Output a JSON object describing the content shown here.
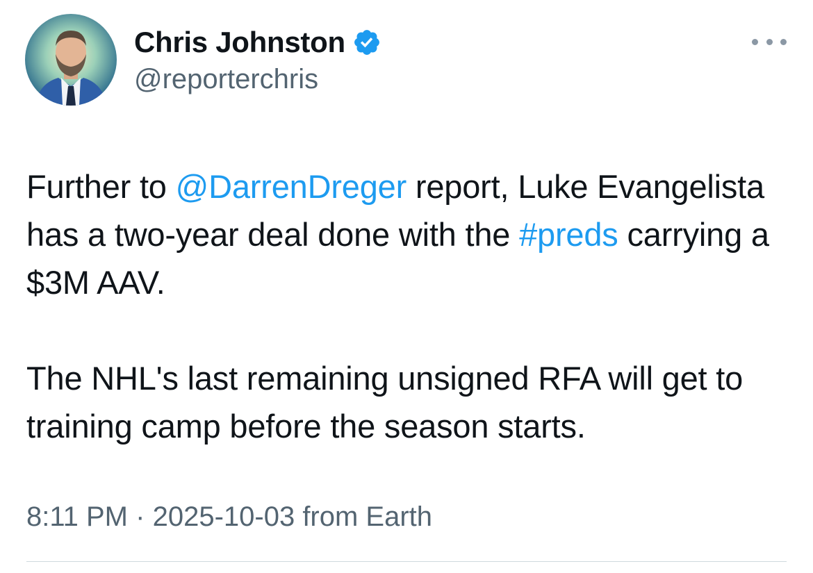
{
  "author": {
    "display_name": "Chris Johnston",
    "handle": "@reporterchris",
    "verified_icon": "verified-badge-icon",
    "verified_color": "#1d9bf0"
  },
  "menu": {
    "icon": "more-options-icon"
  },
  "tweet": {
    "p1_before": "Further to ",
    "p1_mention": "@DarrenDreger",
    "p1_middle": " report, Luke Evangelista has a two-year deal done with the ",
    "p1_hashtag": "#preds",
    "p1_after": " carrying a $3M AAV.",
    "p2": "The NHL's last remaining unsigned RFA will get to training camp before the season starts.",
    "time": "8:11 PM",
    "separator": "·",
    "date": "2025-10-03",
    "source": "from Earth"
  },
  "colors": {
    "text": "#0f1419",
    "secondary": "#536471",
    "link": "#1d9bf0"
  }
}
